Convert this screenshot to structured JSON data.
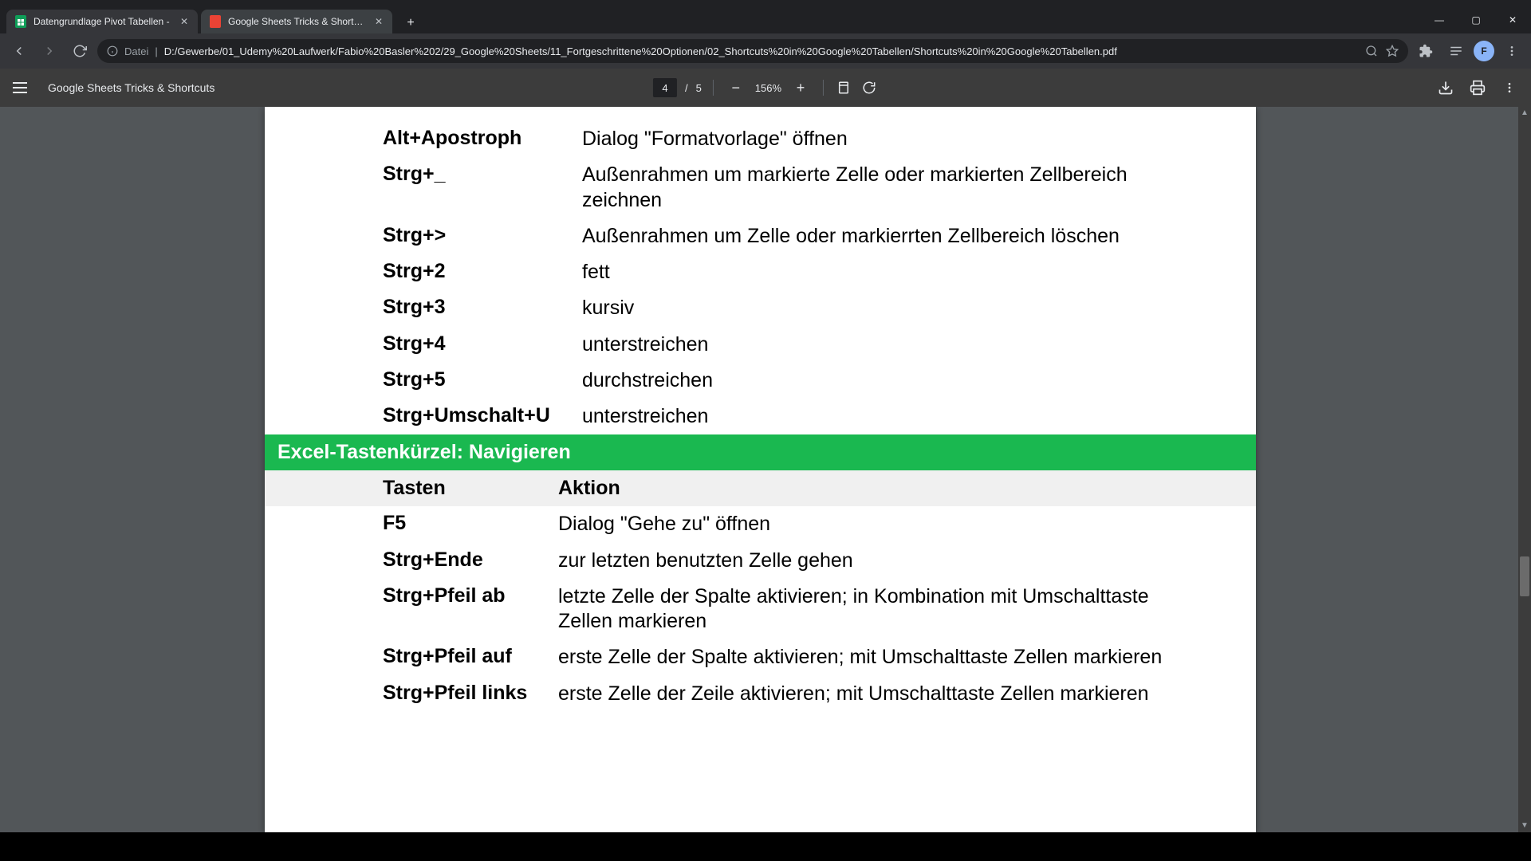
{
  "window": {
    "tabs": [
      {
        "title": "Datengrundlage Pivot Tabellen -",
        "favicon": "sheets"
      },
      {
        "title": "Google Sheets Tricks & Shortcuts",
        "favicon": "pdf"
      }
    ],
    "minimize": "—",
    "maximize": "▢",
    "close": "✕"
  },
  "address": {
    "prefix": "Datei",
    "url": "D:/Gewerbe/01_Udemy%20Laufwerk/Fabio%20Basler%202/29_Google%20Sheets/11_Fortgeschrittene%20Optionen/02_Shortcuts%20in%20Google%20Tabellen/Shortcuts%20in%20Google%20Tabellen.pdf"
  },
  "pdf": {
    "title": "Google Sheets Tricks & Shortcuts",
    "page_current": "4",
    "page_sep": "/",
    "page_total": "5",
    "zoom": "156%"
  },
  "doc": {
    "rows1": [
      {
        "key": "Alt+Apostroph",
        "val": "Dialog \"Formatvorlage\" öffnen"
      },
      {
        "key": "Strg+_",
        "val": "Außenrahmen um markierte Zelle oder markierten Zellbereich zeichnen"
      },
      {
        "key": "Strg+>",
        "val": "Außenrahmen um Zelle oder markierrten Zellbereich löschen"
      },
      {
        "key": "Strg+2",
        "val": "fett"
      },
      {
        "key": "Strg+3",
        "val": "kursiv"
      },
      {
        "key": "Strg+4",
        "val": "unterstreichen"
      },
      {
        "key": "Strg+5",
        "val": "durchstreichen"
      },
      {
        "key": "Strg+Umschalt+U",
        "val": "unterstreichen"
      }
    ],
    "section": "Excel-Tastenkürzel: Navigieren",
    "sub": {
      "h1": "Tasten",
      "h2": "Aktion"
    },
    "rows2": [
      {
        "key": "F5",
        "val": "Dialog \"Gehe zu\" öffnen"
      },
      {
        "key": "Strg+Ende",
        "val": "zur letzten benutzten Zelle gehen"
      },
      {
        "key": "Strg+Pfeil ab",
        "val": "letzte Zelle der Spalte aktivieren; in Kombination mit Umschalttaste Zellen markieren"
      },
      {
        "key": "Strg+Pfeil auf",
        "val": "erste Zelle der Spalte aktivieren; mit Umschalttaste Zellen markieren"
      },
      {
        "key": "Strg+Pfeil links",
        "val": "erste Zelle der Zeile aktivieren; mit Umschalttaste Zellen markieren"
      }
    ]
  }
}
